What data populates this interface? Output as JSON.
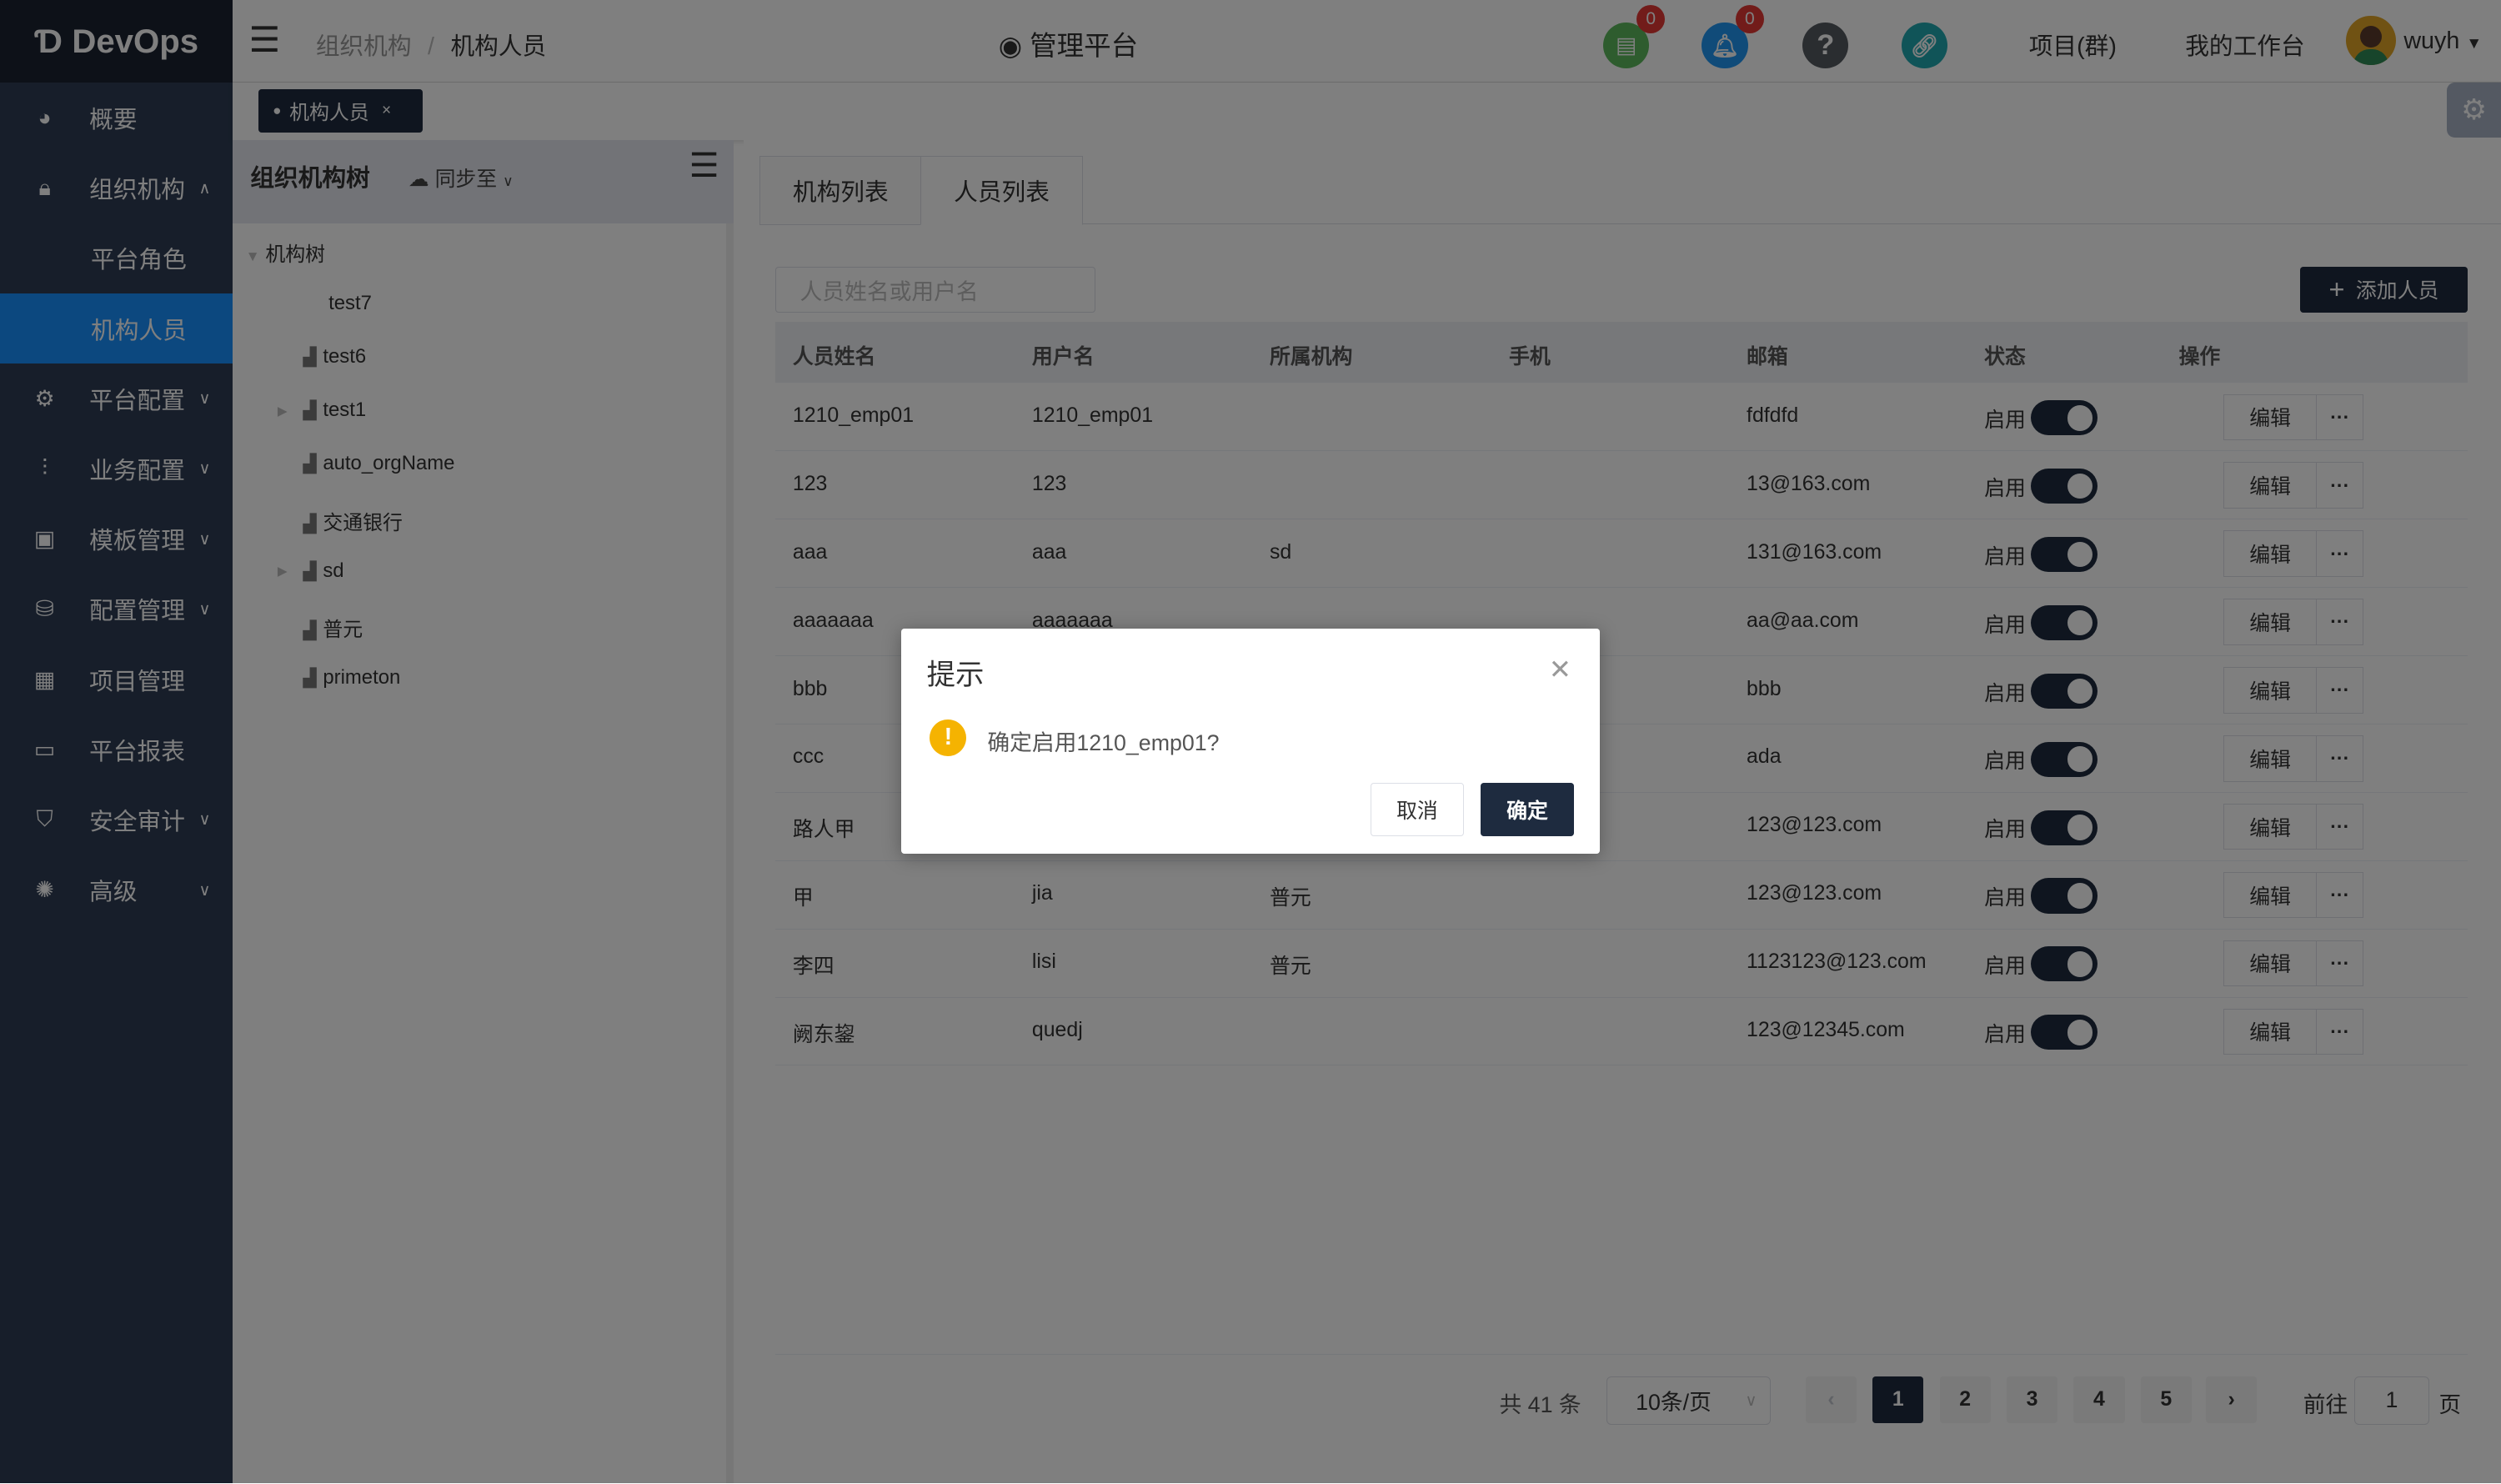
{
  "app": {
    "logo": "DevOps"
  },
  "sidebar": {
    "items": [
      {
        "label": "概要",
        "icon": "dashboard-icon"
      },
      {
        "label": "组织机构",
        "icon": "lock-icon",
        "expanded": true
      },
      {
        "label": "平台角色",
        "sub": true
      },
      {
        "label": "机构人员",
        "sub": true,
        "active": true
      },
      {
        "label": "平台配置",
        "icon": "gear-icon"
      },
      {
        "label": "业务配置",
        "icon": "sliders-icon"
      },
      {
        "label": "模板管理",
        "icon": "template-icon"
      },
      {
        "label": "配置管理",
        "icon": "database-icon"
      },
      {
        "label": "项目管理",
        "icon": "grid-icon"
      },
      {
        "label": "平台报表",
        "icon": "monitor-icon"
      },
      {
        "label": "安全审计",
        "icon": "shield-icon"
      },
      {
        "label": "高级",
        "icon": "advanced-icon"
      }
    ]
  },
  "header": {
    "breadcrumb": [
      "组织机构",
      "机构人员"
    ],
    "platform": "管理平台",
    "doc_badge": "0",
    "bell_badge": "0",
    "projects": "项目(群)",
    "workbench": "我的工作台",
    "user": "wuyh",
    "colors": {
      "doc": "#5cb85c",
      "bell": "#2196f3",
      "help": "#555a61",
      "link": "#20a8b0"
    }
  },
  "tagbar": {
    "tag": "机构人员",
    "close": "×"
  },
  "tree": {
    "title": "组织机构树",
    "sync": "同步至",
    "root": "机构树",
    "nodes": [
      "test7",
      "test6",
      "test1",
      "auto_orgName",
      "交通银行",
      "sd",
      "普元",
      "primeton"
    ]
  },
  "tabs": [
    "机构列表",
    "人员列表"
  ],
  "search": {
    "placeholder": "人员姓名或用户名"
  },
  "add_button": "添加人员",
  "table": {
    "headers": [
      "人员姓名",
      "用户名",
      "所属机构",
      "手机",
      "邮箱",
      "状态",
      "操作"
    ],
    "rows": [
      [
        "1210_emp01",
        "1210_emp01",
        "",
        "",
        "fdfdfd",
        "启用"
      ],
      [
        "123",
        "123",
        "",
        "",
        "13@163.com",
        "启用"
      ],
      [
        "aaa",
        "aaa",
        "sd",
        "",
        "131@163.com",
        "启用"
      ],
      [
        "aaaaaaa",
        "aaaaaaa",
        "",
        "",
        "aa@aa.com",
        "启用"
      ],
      [
        "bbb",
        "",
        "",
        "",
        "bbb",
        "启用"
      ],
      [
        "ccc",
        "",
        "",
        "",
        "ada",
        "启用"
      ],
      [
        "路人甲",
        "",
        "",
        "",
        "123@123.com",
        "启用"
      ],
      [
        "甲",
        "jia",
        "普元",
        "",
        "123@123.com",
        "启用"
      ],
      [
        "李四",
        "lisi",
        "普元",
        "",
        "1123123@123.com",
        "启用"
      ],
      [
        "阙东鋆",
        "quedj",
        "",
        "",
        "123@12345.com",
        "启用"
      ]
    ],
    "edit": "编辑",
    "more": "···"
  },
  "pagination": {
    "total": "共 41 条",
    "page_size": "10条/页",
    "pages": [
      "1",
      "2",
      "3",
      "4",
      "5"
    ],
    "current": "1",
    "goto": "前往",
    "goto_value": "1",
    "page_unit": "页"
  },
  "dialog": {
    "title": "提示",
    "message": "确定启用1210_emp01?",
    "cancel": "取消",
    "confirm": "确定"
  }
}
